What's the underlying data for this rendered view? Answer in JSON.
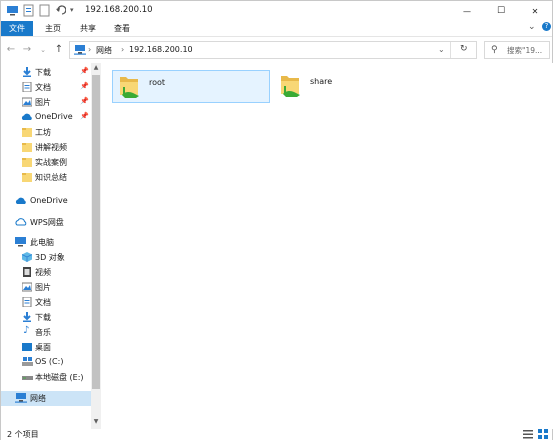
{
  "window": {
    "title": "192.168.200.10",
    "minimize_glyph": "—",
    "maximize_glyph": "☐",
    "close_glyph": "✕"
  },
  "ribbon": {
    "tabs": [
      "文件",
      "主页",
      "共享",
      "查看"
    ],
    "collapse_glyph": "⌄",
    "help_glyph": "?"
  },
  "address": {
    "path": [
      "网络",
      "192.168.200.10"
    ],
    "search_placeholder": "搜索\"19..."
  },
  "sidebar": {
    "quick_access": [
      {
        "label": "下载",
        "icon": "download-arrow-icon",
        "pinned": true
      },
      {
        "label": "文档",
        "icon": "document-icon",
        "pinned": true
      },
      {
        "label": "图片",
        "icon": "picture-icon",
        "pinned": true
      },
      {
        "label": "OneDrive",
        "icon": "cloud-icon",
        "pinned": true
      },
      {
        "label": "工坊",
        "icon": "folder-icon",
        "pinned": false
      },
      {
        "label": "讲解视频",
        "icon": "folder-icon",
        "pinned": false
      },
      {
        "label": "实战案例",
        "icon": "folder-icon",
        "pinned": false
      },
      {
        "label": "知识总结",
        "icon": "folder-icon",
        "pinned": false
      }
    ],
    "onedrive": "OneDrive",
    "wps": "WPS网盘",
    "this_pc": "此电脑",
    "pc_items": [
      {
        "label": "3D 对象",
        "icon": "3d-objects-icon"
      },
      {
        "label": "视频",
        "icon": "video-icon"
      },
      {
        "label": "图片",
        "icon": "picture-icon"
      },
      {
        "label": "文档",
        "icon": "document-icon"
      },
      {
        "label": "下载",
        "icon": "download-arrow-icon"
      },
      {
        "label": "音乐",
        "icon": "music-icon"
      },
      {
        "label": "桌面",
        "icon": "desktop-icon"
      },
      {
        "label": "OS (C:)",
        "icon": "drive-c-icon"
      },
      {
        "label": "本地磁盘 (E:)",
        "icon": "drive-icon"
      }
    ],
    "network": "网络"
  },
  "content": {
    "items": [
      {
        "name": "root",
        "icon": "network-share-folder-icon",
        "selected": true
      },
      {
        "name": "share",
        "icon": "network-share-folder-icon",
        "selected": false
      }
    ]
  },
  "status": {
    "text": "2 个项目"
  },
  "colors": {
    "accent": "#1979ca",
    "selection_bg": "#e5f3ff",
    "selection_border": "#99d1ff",
    "nav_selected": "#cce4f7",
    "folder": "#f8d775"
  }
}
